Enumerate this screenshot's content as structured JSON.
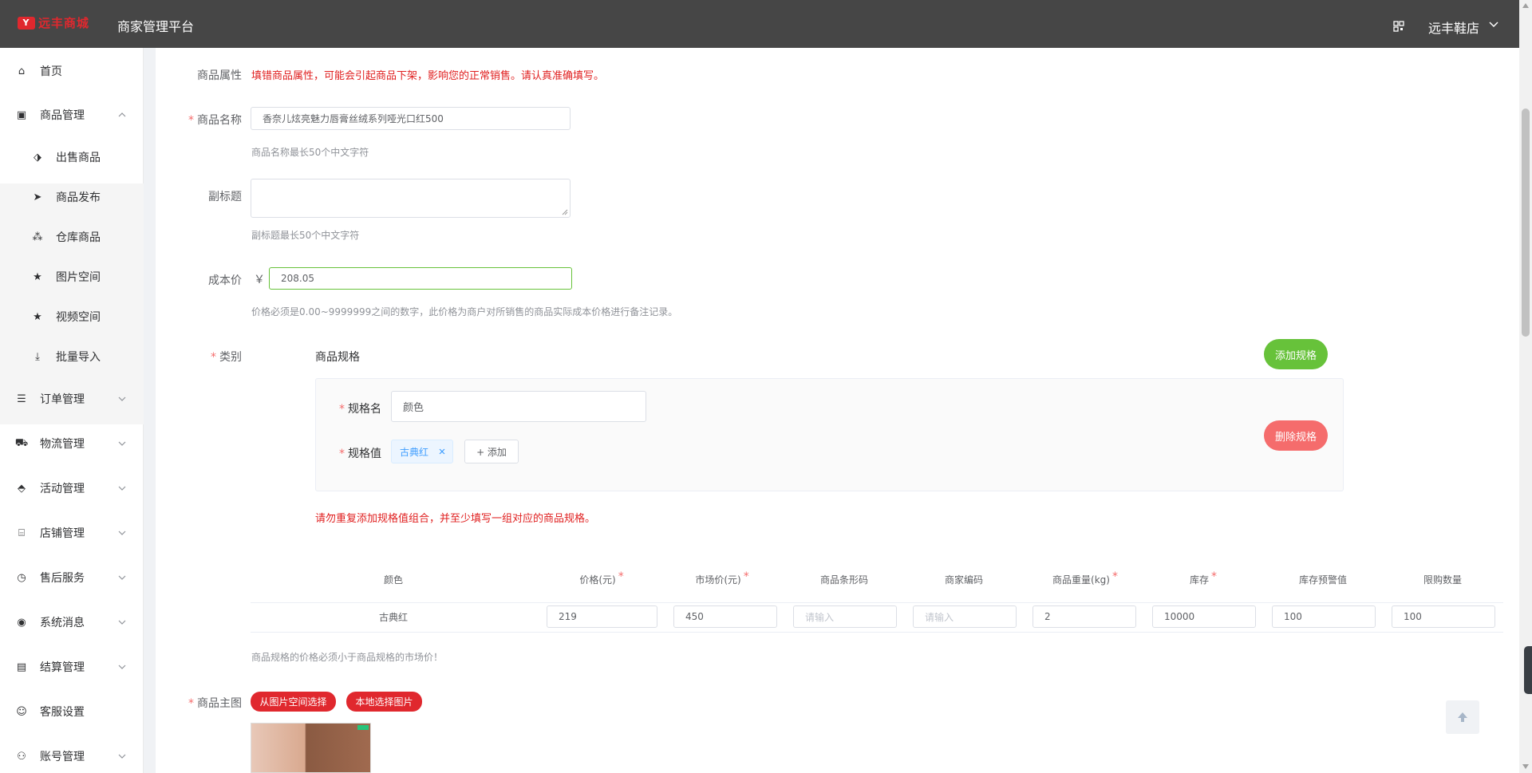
{
  "header": {
    "logo_text": "远丰商城",
    "platform_title": "商家管理平台",
    "shop_name": "远丰鞋店"
  },
  "sidebar": {
    "items": [
      {
        "label": "首页",
        "icon": "home-icon"
      },
      {
        "label": "商品管理",
        "icon": "goods-icon",
        "expanded": true
      },
      {
        "label": "订单管理",
        "icon": "order-icon"
      },
      {
        "label": "物流管理",
        "icon": "truck-icon"
      },
      {
        "label": "活动管理",
        "icon": "tag-icon"
      },
      {
        "label": "店铺管理",
        "icon": "store-icon"
      },
      {
        "label": "售后服务",
        "icon": "service-icon"
      },
      {
        "label": "系统消息",
        "icon": "message-icon"
      },
      {
        "label": "结算管理",
        "icon": "settlement-icon"
      },
      {
        "label": "客服设置",
        "icon": "customer-service-icon"
      },
      {
        "label": "账号管理",
        "icon": "account-icon"
      }
    ],
    "sub_items": [
      {
        "label": "出售商品",
        "icon": "price-tag-icon"
      },
      {
        "label": "商品发布",
        "icon": "send-icon"
      },
      {
        "label": "仓库商品",
        "icon": "warehouse-icon"
      },
      {
        "label": "图片空间",
        "icon": "star-icon"
      },
      {
        "label": "视频空间",
        "icon": "star-icon"
      },
      {
        "label": "批量导入",
        "icon": "import-icon"
      }
    ]
  },
  "form": {
    "attr_label": "商品属性",
    "attr_warning": "填错商品属性，可能会引起商品下架，影响您的正常销售。请认真准确填写。",
    "name_label": "商品名称",
    "name_value": "香奈儿炫亮魅力唇膏丝绒系列哑光口红500",
    "name_hint": "商品名称最长50个中文字符",
    "subtitle_label": "副标题",
    "subtitle_value": "",
    "subtitle_hint": "副标题最长50个中文字符",
    "cost_label": "成本价",
    "currency": "￥",
    "cost_value": "208.05",
    "cost_hint": "价格必须是0.00~9999999之间的数字，此价格为商户对所销售的商品实际成本价格进行备注记录。",
    "category_label": "类别",
    "spec_title": "商品规格",
    "add_spec_button": "添加规格",
    "spec_name_label": "规格名",
    "spec_name_value": "颜色",
    "spec_value_label": "规格值",
    "spec_value_tag": "古典红",
    "add_value_button": "+ 添加",
    "delete_spec_button": "删除规格",
    "spec_warning": "请勿重复添加规格值组合，并至少填写一组对应的商品规格。",
    "spec_table_hint": "商品规格的价格必须小于商品规格的市场价！",
    "main_image_label": "商品主图",
    "pick_from_space_button": "从图片空间选择",
    "pick_local_button": "本地选择图片"
  },
  "spec_table": {
    "headers": [
      "颜色",
      "价格(元)",
      "市场价(元)",
      "商品条形码",
      "商家编码",
      "商品重量(kg)",
      "库存",
      "库存预警值",
      "限购数量"
    ],
    "required_columns": [
      1,
      2,
      5,
      6
    ],
    "row": {
      "color": "古典红",
      "price": "219",
      "market_price": "450",
      "barcode_placeholder": "请输入",
      "merchant_code_placeholder": "请输入",
      "weight": "2",
      "stock": "10000",
      "stock_warning": "100",
      "purchase_limit": "100"
    }
  },
  "colors": {
    "accent_green": "#67c23a",
    "danger_red": "#f56c6c",
    "brand_red": "#e0282e",
    "header_bg": "#464646"
  }
}
